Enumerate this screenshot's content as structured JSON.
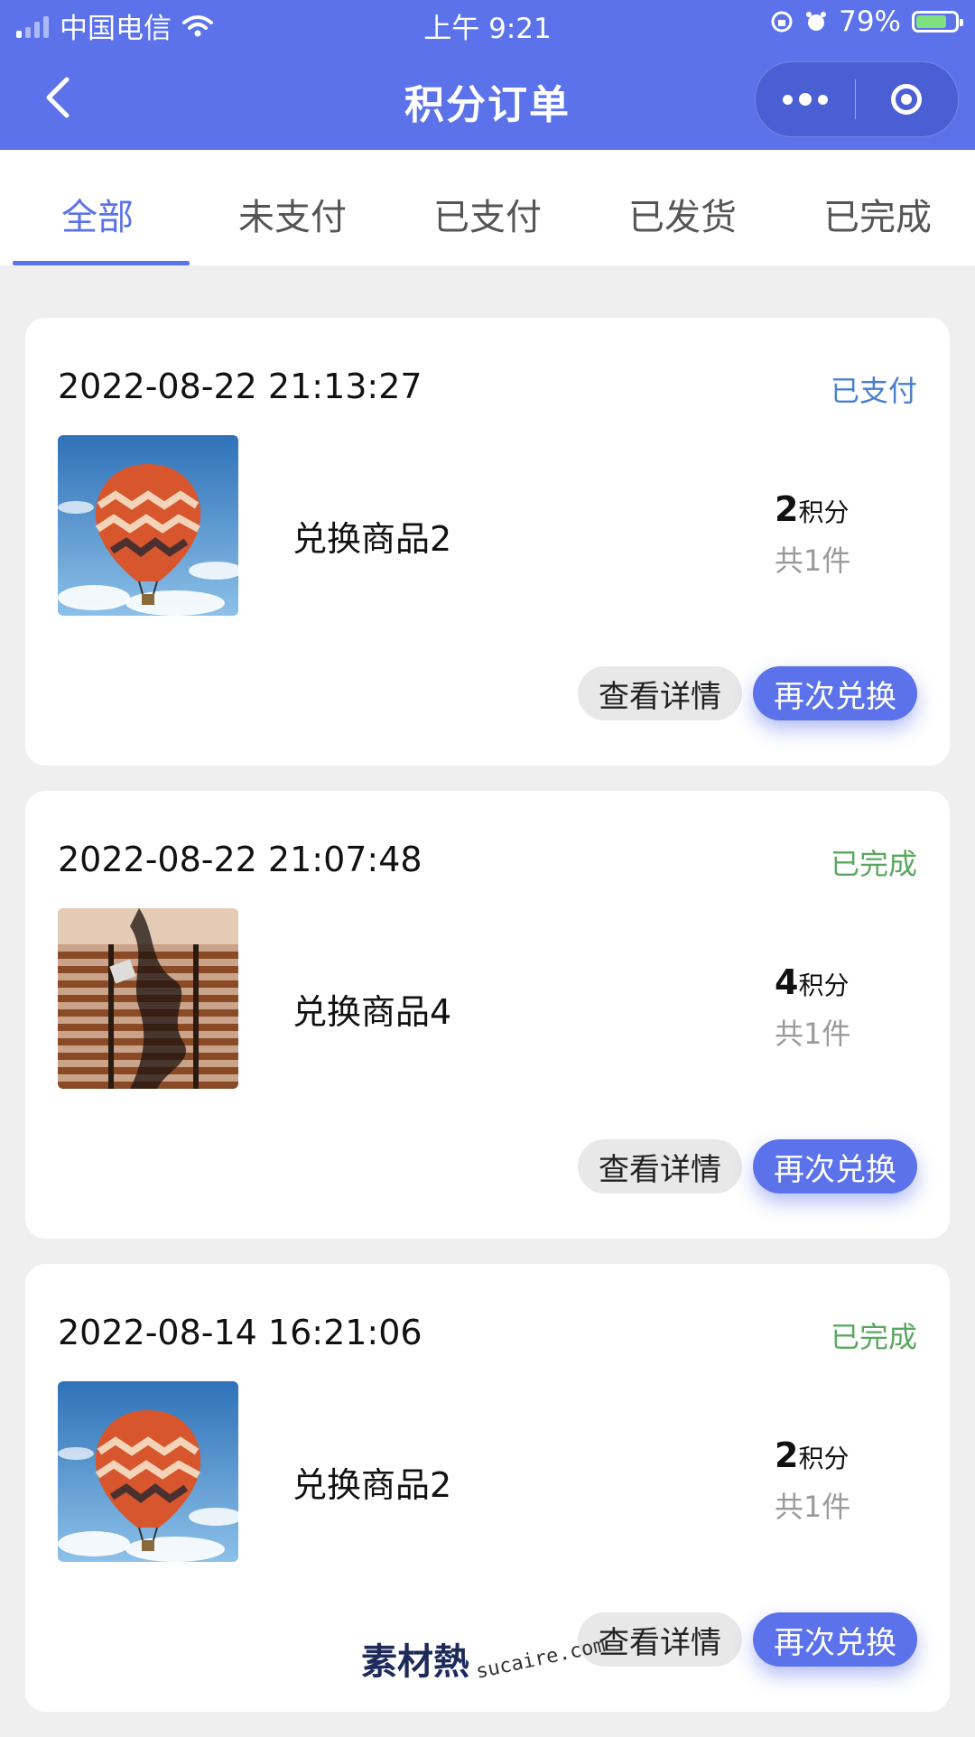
{
  "status_bar": {
    "carrier": "中国电信",
    "time": "上午 9:21",
    "battery": "79%",
    "battery_level": 0.79
  },
  "nav": {
    "title": "积分订单",
    "back_icon": "chevron-left-icon",
    "more_icon": "more-dots-icon",
    "close_icon": "target-circle-icon"
  },
  "tabs": [
    {
      "label": "全部",
      "active": true
    },
    {
      "label": "未支付",
      "active": false
    },
    {
      "label": "已支付",
      "active": false
    },
    {
      "label": "已发货",
      "active": false
    },
    {
      "label": "已完成",
      "active": false
    }
  ],
  "orders": [
    {
      "time": "2022-08-22 21:13:27",
      "status": "已支付",
      "status_color": "#4a7fd0",
      "image": "hot-air-balloon",
      "name": "兑换商品2",
      "points": "2",
      "points_unit": "积分",
      "qty": "共1件",
      "detail_label": "查看详情",
      "again_label": "再次兑换"
    },
    {
      "time": "2022-08-22 21:07:48",
      "status": "已完成",
      "status_color": "#5aa860",
      "image": "window-blinds-shadow",
      "name": "兑换商品4",
      "points": "4",
      "points_unit": "积分",
      "qty": "共1件",
      "detail_label": "查看详情",
      "again_label": "再次兑换"
    },
    {
      "time": "2022-08-14 16:21:06",
      "status": "已完成",
      "status_color": "#5aa860",
      "image": "hot-air-balloon",
      "name": "兑换商品2",
      "points": "2",
      "points_unit": "积分",
      "qty": "共1件",
      "detail_label": "查看详情",
      "again_label": "再次兑换"
    }
  ],
  "watermark": {
    "logo": "素材熱",
    "url": "sucaire.com"
  },
  "colors": {
    "primary": "#5b72ea",
    "background": "#efefef"
  }
}
